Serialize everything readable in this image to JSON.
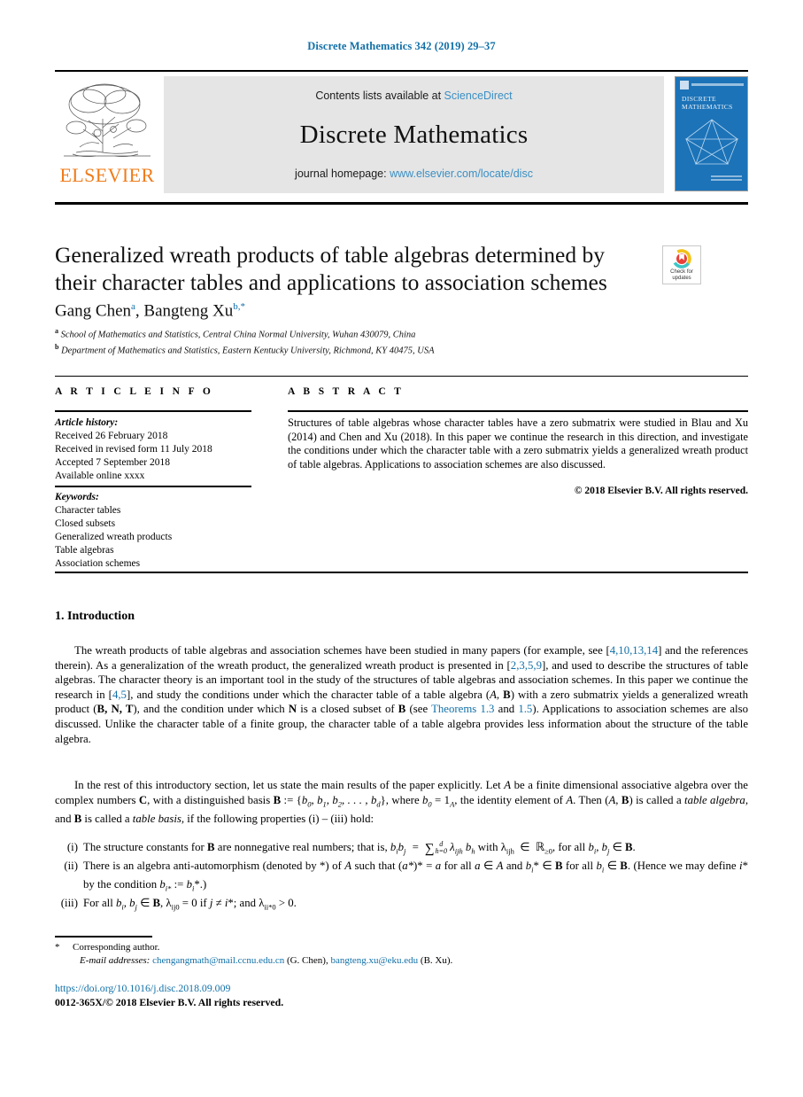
{
  "running_head": "Discrete Mathematics 342 (2019) 29–37",
  "masthead": {
    "contents_prefix": "Contents lists available at ",
    "sciencedirect": "ScienceDirect",
    "journal_name": "Discrete Mathematics",
    "homepage_prefix": "journal homepage: ",
    "homepage_url": "www.elsevier.com/locate/disc",
    "publisher": "ELSEVIER",
    "cover_title_line1": "DISCRETE",
    "cover_title_line2": "MATHEMATICS",
    "link_color": "#3a8fc4",
    "cover_color": "#1c73b8",
    "publisher_color": "#f07c1a",
    "panel_color": "#e5e5e5"
  },
  "article": {
    "title": "Generalized wreath products of table algebras determined by their character tables and applications to association schemes",
    "author1": "Gang Chen",
    "author1_mark": "a",
    "author2": "Bangteng Xu",
    "author2_mark": "b,*",
    "affiliation_a_mark": "a",
    "affiliation_a": "School of Mathematics and Statistics, Central China Normal University, Wuhan  430079, China",
    "affiliation_b_mark": "b",
    "affiliation_b": "Department of Mathematics and Statistics, Eastern Kentucky University, Richmond, KY 40475, USA"
  },
  "crossmark": {
    "label_line1": "Check for",
    "label_line2": "updates"
  },
  "info": {
    "heading": "A R T I C L E   I N F O",
    "history_label": "Article history:",
    "history": [
      "Received 26 February 2018",
      "Received in revised form 11 July 2018",
      "Accepted 7 September 2018",
      "Available online  xxxx"
    ],
    "keywords_label": "Keywords:",
    "keywords": [
      "Character tables",
      "Closed subsets",
      "Generalized wreath products",
      "Table algebras",
      "Association schemes"
    ]
  },
  "abstract": {
    "heading": "A B S T R A C T",
    "text": "Structures of table algebras whose character tables have a zero submatrix were studied in Blau and Xu (2014) and Chen and Xu (2018). In this paper we continue the research in this direction, and investigate the conditions under which the character table with a zero submatrix yields a generalized wreath product of table algebras. Applications to association schemes are also discussed.",
    "copyright": "© 2018 Elsevier B.V. All rights reserved."
  },
  "section": {
    "number_and_title": "1.  Introduction"
  },
  "paragraphs": {
    "p1_t1": "The wreath products of table algebras and association schemes have been studied in many papers (for example, see [",
    "p1_refs1": "4,10,13,14",
    "p1_t2": "] and the references therein). As a generalization of the wreath product, the generalized wreath product is presented in [",
    "p1_refs2": "2,3,5,9",
    "p1_t3": "], and used to describe the structures of table algebras. The character theory is an important tool in the study of the structures of table algebras and association schemes. In this paper we continue the research in [",
    "p1_refs3": "4,5",
    "p1_t4": "], and study the conditions under which the character table of a table algebra (",
    "p1_A": "A",
    "p1_t5": ", ",
    "p1_B": "B",
    "p1_t6": ") with a zero submatrix yields a generalized wreath product (",
    "p1_BNT": "B, N, T",
    "p1_t7": "), and the condition under which ",
    "p1_N": "N",
    "p1_t8": " is a closed subset of ",
    "p1_B2": "B",
    "p1_t9": " (see ",
    "p1_thm_label": "Theorems 1.3",
    "p1_t10": " and ",
    "p1_thm2": "1.5",
    "p1_t11": "). Applications to association schemes are also discussed. Unlike the character table of a finite group, the character table of a table algebra provides less information about the structure of the table algebra.",
    "p2_t1": "In the rest of this introductory section, let us state the main results of the paper explicitly. Let ",
    "p2_A": "A",
    "p2_t2": " be a finite dimensional associative algebra over the complex numbers ",
    "p2_C": "C",
    "p2_t3": ", with a distinguished basis ",
    "p2_B": "B",
    "p2_t4": " := {",
    "p2_basis": "b0, b1, b2, . . . , bd",
    "p2_t5": "}, where ",
    "p2_b0": "b0",
    "p2_t6": " = 1",
    "p2_Asub": "A",
    "p2_t7": ", the identity element of ",
    "p2_A2": "A",
    "p2_t8": ". Then (",
    "p2_A3": "A",
    "p2_t9": ", ",
    "p2_B2": "B",
    "p2_t10": ") is called a ",
    "p2_tablealgebra": "table algebra",
    "p2_t11": ", and ",
    "p2_B3": "B",
    "p2_t12": " is called a ",
    "p2_tablebasis": "table basis",
    "p2_t13": ", if the following properties (i) – (iii) hold:"
  },
  "list_items": [
    {
      "marker": "(i)",
      "text_a": "The structure constants for ",
      "bold_B": "B",
      "text_b": " are nonnegative real numbers; that is, ",
      "formula": "bibj  =  ∑d h=0 λijh bh",
      "text_c": " with λijh  ∈  R≥0, for all bi, bj ∈ ",
      "bold_B2": "B",
      "text_d": "."
    },
    {
      "marker": "(ii)",
      "text_a": "There is an algebra anti-automorphism (denoted by *) of A such that (a*)* = a for all a ∈ A and bi* ∈ B for all bi ∈ ",
      "bold_B": "B",
      "text_b": ". (Hence we may define i* by the condition bi* := bi*.)"
    },
    {
      "marker": "(iii)",
      "text_a": "For all bi, bj ∈ ",
      "bold_B": "B",
      "text_b": ", λij0 = 0 if j ≠ i*; and λii*0 > 0."
    }
  ],
  "footnotes": {
    "star": "*",
    "corresponding": "Corresponding author.",
    "email_label": "E-mail addresses:",
    "email1": "chengangmath@mail.ccnu.edu.cn",
    "email1_owner": "(G. Chen)",
    "email2": "bangteng.xu@eku.edu",
    "email2_owner": "(B. Xu)",
    "doi": "https://doi.org/10.1016/j.disc.2018.09.009",
    "issn_line": "0012-365X/© 2018 Elsevier B.V. All rights reserved."
  }
}
